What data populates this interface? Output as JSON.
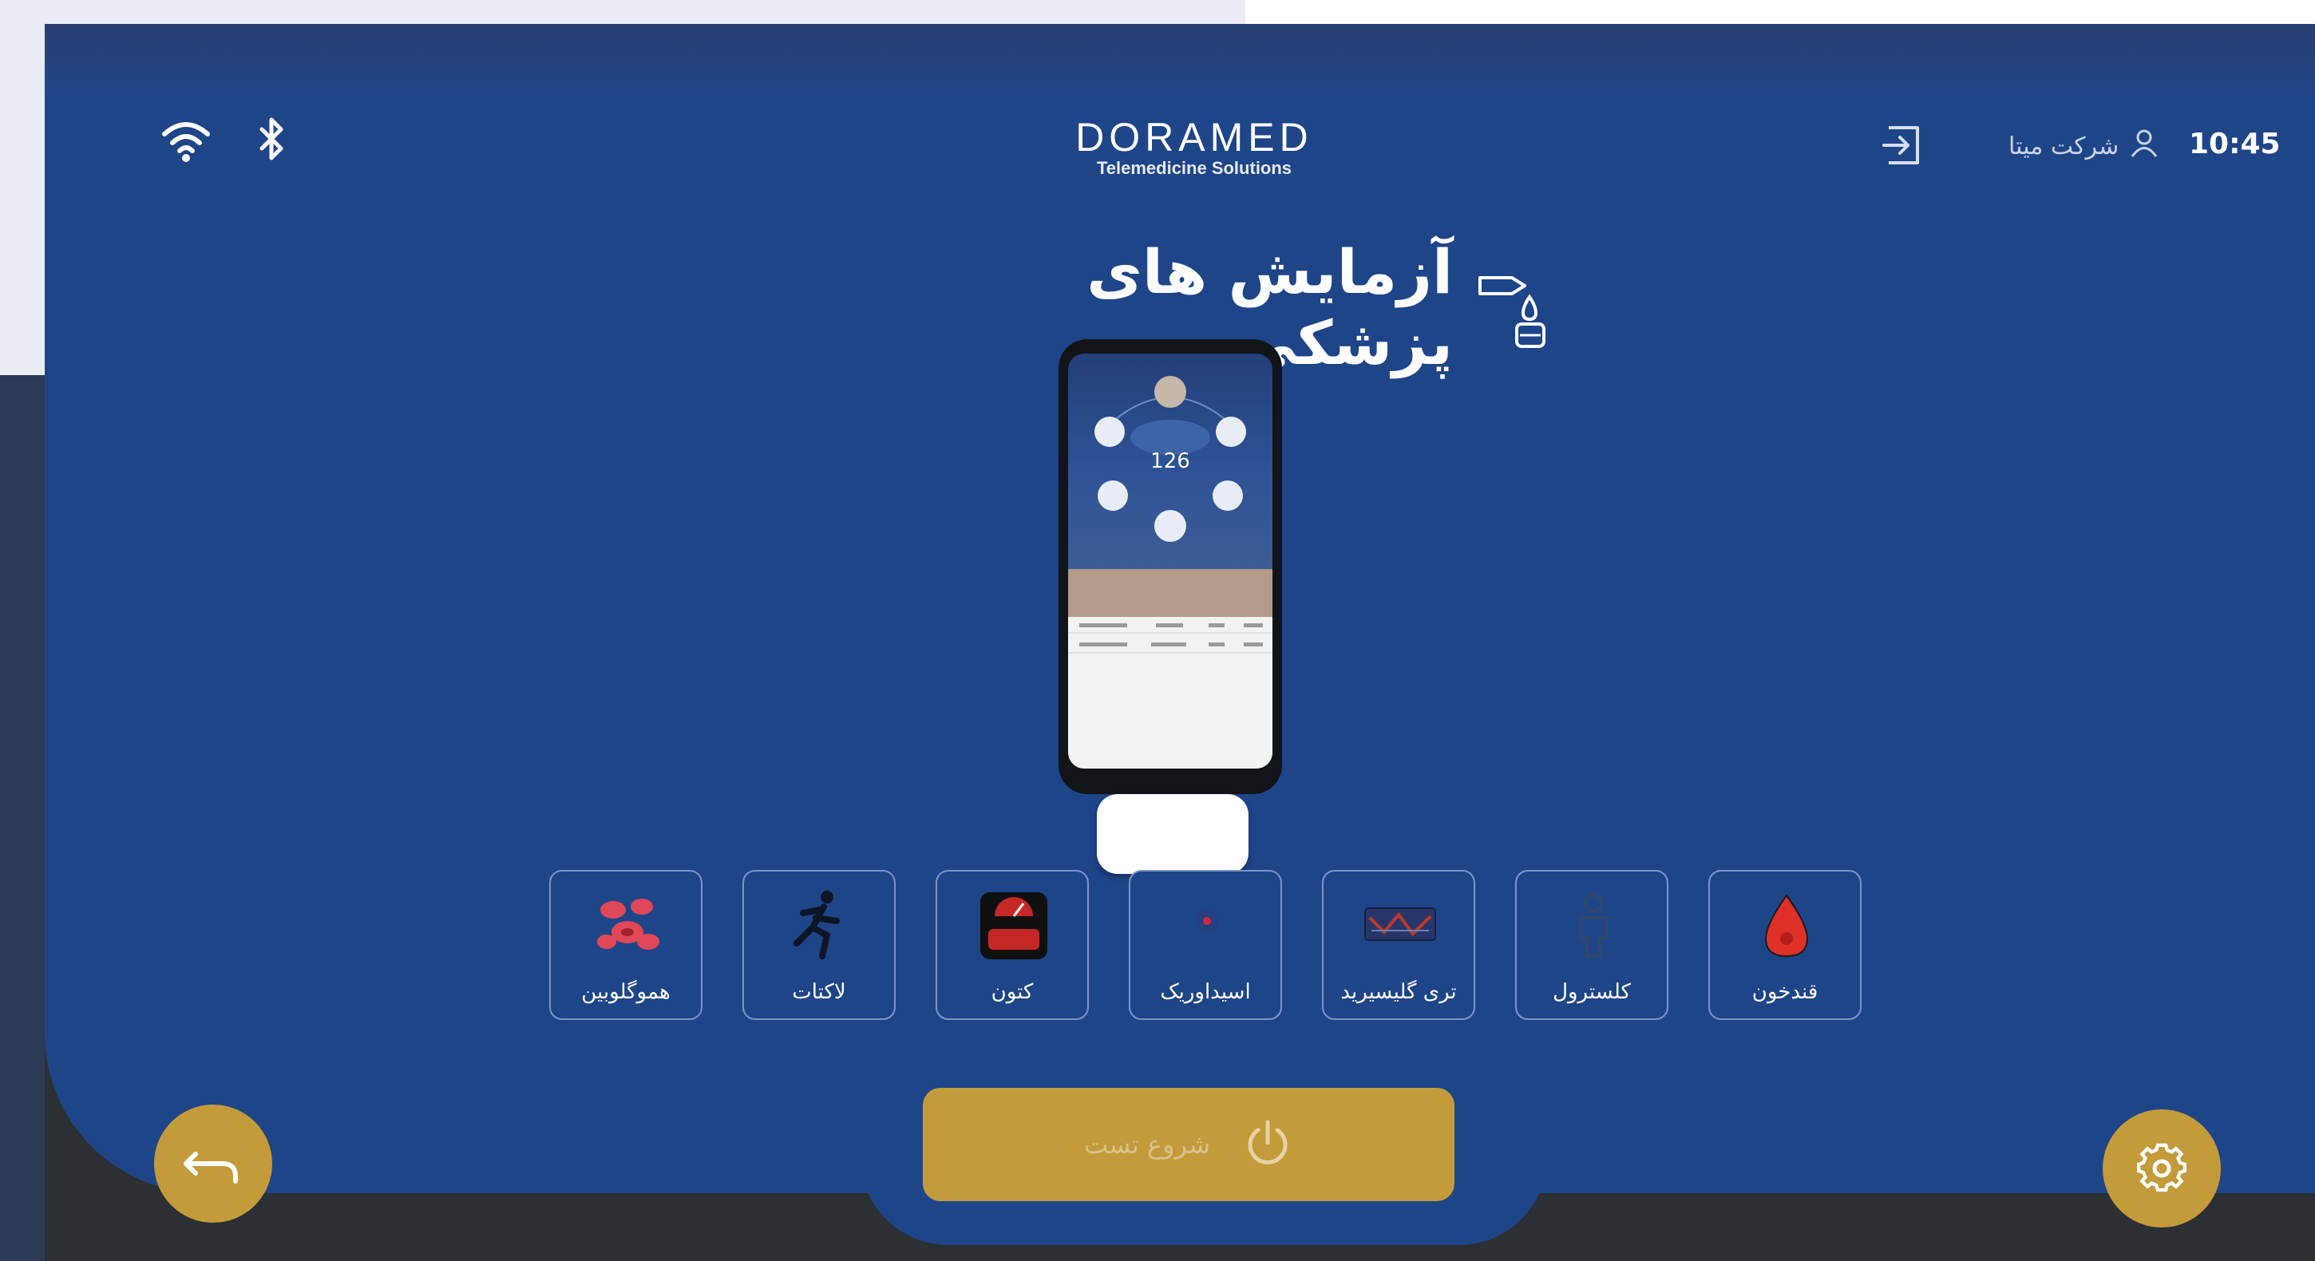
{
  "status": {
    "wifi_icon": "wifi-icon",
    "bluetooth_icon": "bluetooth-icon"
  },
  "brand": {
    "name": "DORAMED",
    "tagline": "Telemedicine Solutions"
  },
  "header": {
    "exit_icon": "exit-icon",
    "company": "شرکت میتا",
    "user_icon": "user-icon",
    "time": "10:45"
  },
  "page": {
    "title": "آزمایش های پزشکی",
    "title_icon": "test-device-icon"
  },
  "device": {
    "reading": "126"
  },
  "tests": [
    {
      "label": "قندخون",
      "icon": "blood-drop-icon",
      "color": "#e0302a"
    },
    {
      "label": "کلسترول",
      "icon": "body-icon",
      "color": "#33466a"
    },
    {
      "label": "تری گلیسیرید",
      "icon": "triglyceride-icon",
      "color": "#c0392b"
    },
    {
      "label": "اسیداوریک",
      "icon": "uric-acid-icon",
      "color": "#d7263d"
    },
    {
      "label": "کتون",
      "icon": "ketone-scale-icon",
      "color": "#c62828"
    },
    {
      "label": "لاکتات",
      "icon": "runner-icon",
      "color": "#0d1526"
    },
    {
      "label": "هموگلوبین",
      "icon": "blood-cells-icon",
      "color": "#e0485a"
    }
  ],
  "actions": {
    "start_label": "شروع تست",
    "power_icon": "power-icon",
    "back_icon": "back-arrow-icon",
    "settings_icon": "gear-icon"
  },
  "colors": {
    "panel": "#1f4589",
    "accent": "#c39b3a",
    "bezel": "#2c2f33"
  }
}
